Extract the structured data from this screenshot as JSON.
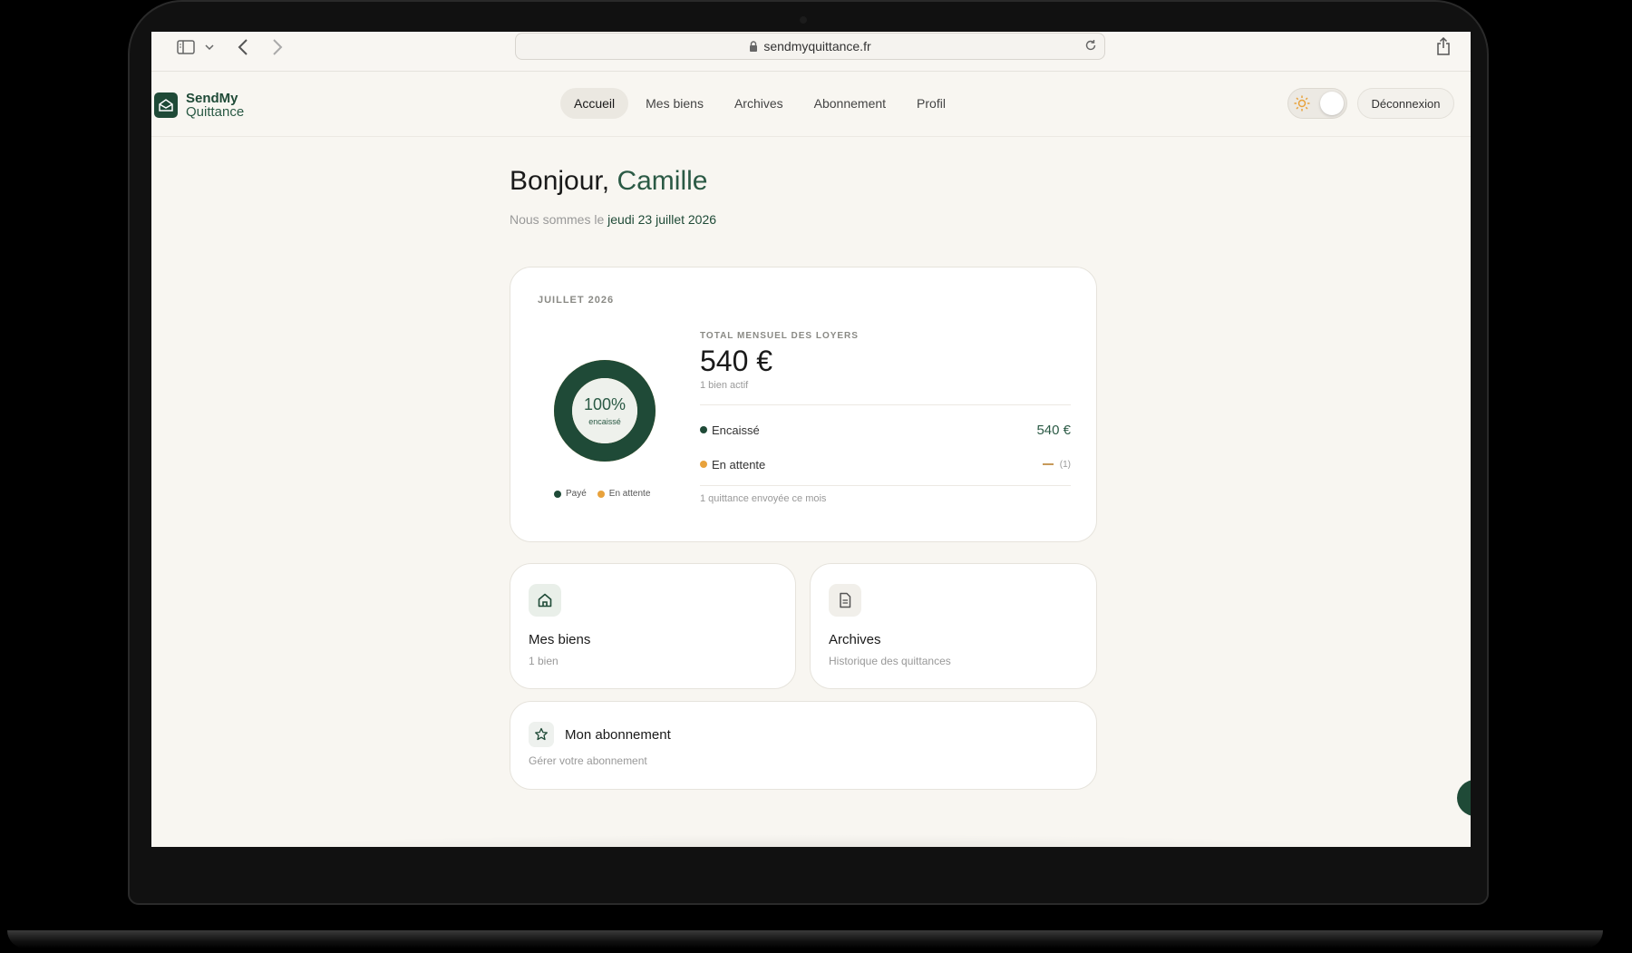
{
  "browser": {
    "url": "sendmyquittance.fr",
    "icons": [
      "sidebar-icon",
      "chevron-down-icon",
      "back-icon",
      "forward-icon",
      "lock-icon",
      "reload-icon",
      "share-icon"
    ]
  },
  "app": {
    "logo_line1": "SendMy",
    "logo_line2": "Quittance",
    "brand_color": "#1f4a37",
    "accent_color": "#e8a23c"
  },
  "nav": {
    "tabs": [
      {
        "label": "Accueil",
        "active": true
      },
      {
        "label": "Mes biens",
        "active": false
      },
      {
        "label": "Archives",
        "active": false
      },
      {
        "label": "Abonnement",
        "active": false
      },
      {
        "label": "Profil",
        "active": false
      }
    ],
    "theme_toggle_icon": "sun-icon",
    "logout_label": "Déconnexion"
  },
  "greeting": {
    "prefix": "Bonjour,",
    "name": "Camille",
    "date_prefix": "Nous sommes le",
    "date": "jeudi 23 juillet 2026"
  },
  "summary": {
    "month": "JUILLET 2026",
    "donut_percent": "100%",
    "donut_label": "encaissé",
    "paid_fraction": 1.0,
    "legend_paid": "Payé",
    "legend_pending": "En attente",
    "total_label": "TOTAL MENSUEL DES LOYERS",
    "total_value": "540 €",
    "total_sub": "1 bien actif",
    "collected_label": "Encaissé",
    "collected_value": "540 €",
    "pending_label": "En attente",
    "pending_count": "(1)",
    "footer": "1 quittance envoyée ce mois"
  },
  "tiles": {
    "properties_title": "Mes biens",
    "properties_sub": "1 bien",
    "archives_title": "Archives",
    "archives_sub": "Historique des quittances",
    "subscription_title": "Mon abonnement",
    "subscription_sub": "Gérer votre abonnement"
  }
}
